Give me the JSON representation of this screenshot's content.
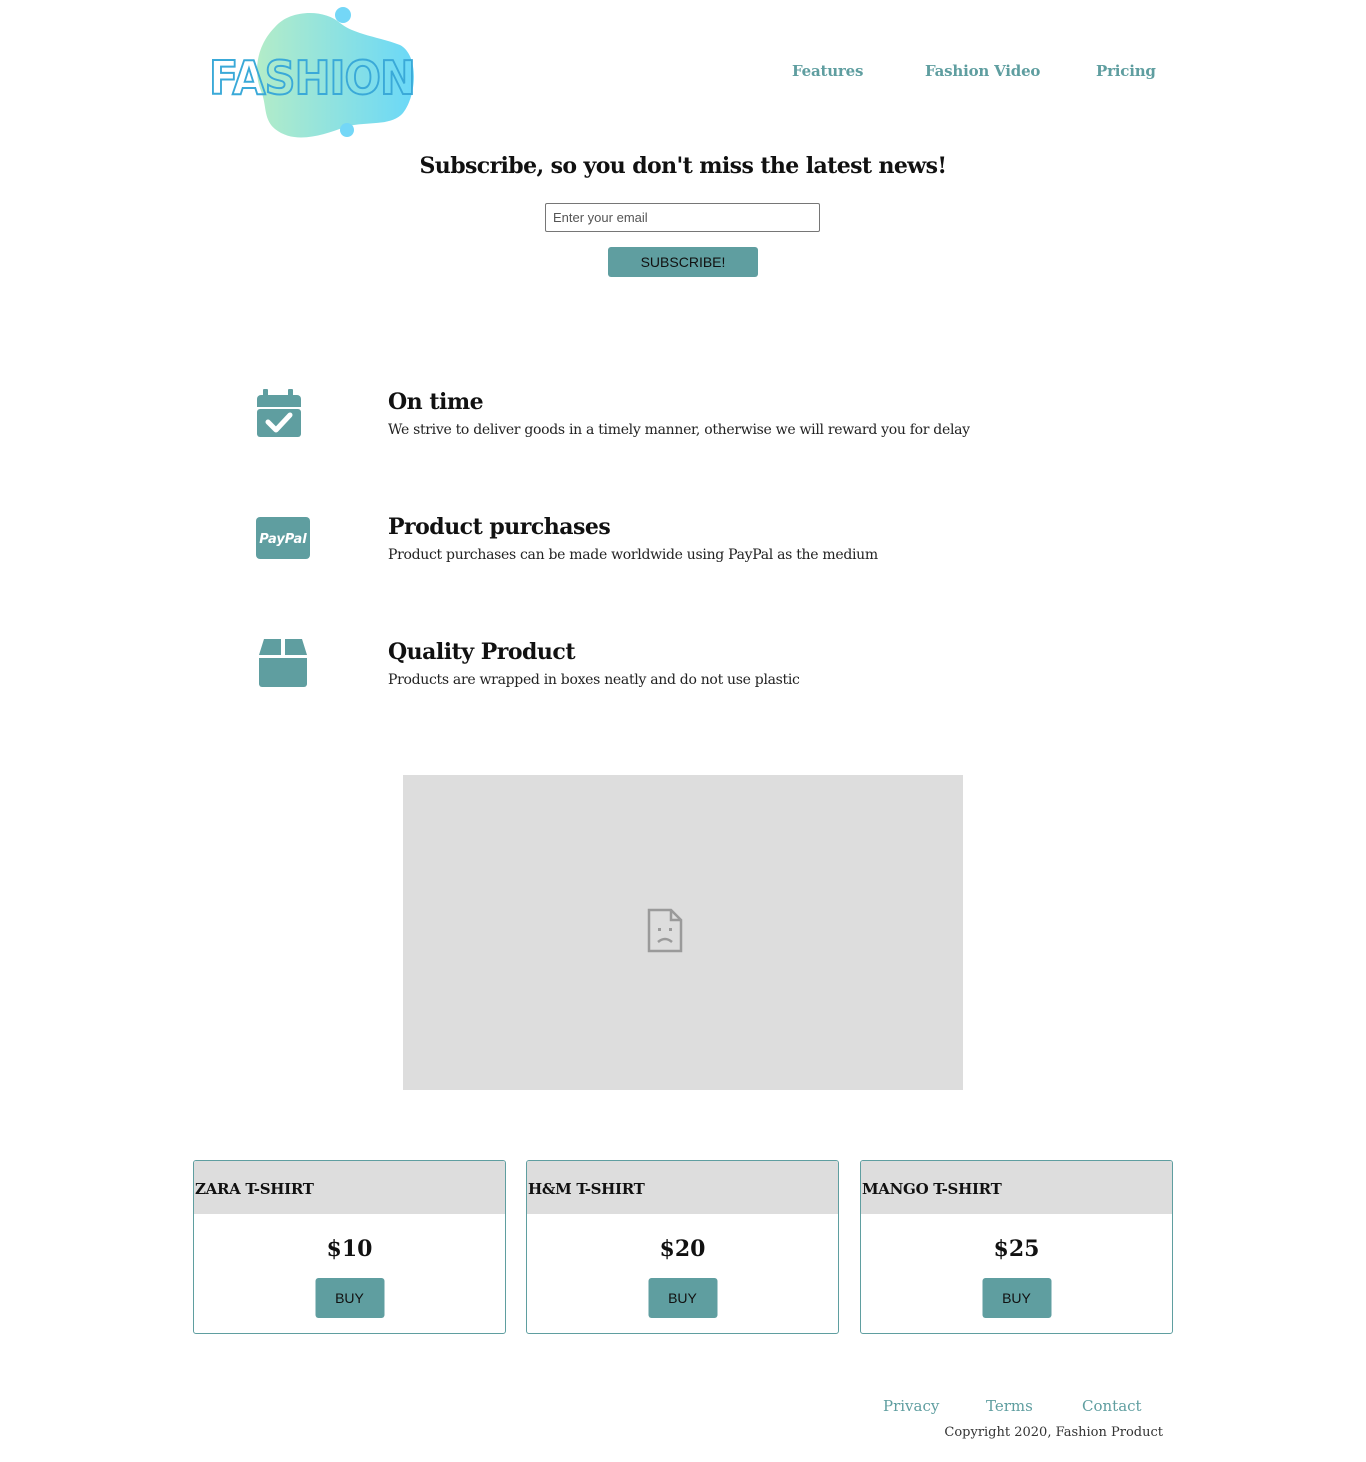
{
  "header": {
    "logo_text": "FASHION",
    "nav": [
      {
        "label": "Features"
      },
      {
        "label": "Fashion Video"
      },
      {
        "label": "Pricing"
      }
    ]
  },
  "subscribe": {
    "title": "Subscribe, so you don't miss the latest news!",
    "email_placeholder": "Enter your email",
    "button_label": "SUBSCRIBE!"
  },
  "features": [
    {
      "icon": "calendar-check-icon",
      "title": "On time",
      "text": "We strive to deliver goods in a timely manner, otherwise we will reward you for delay"
    },
    {
      "icon": "paypal-icon",
      "icon_text": "PayPal",
      "title": "Product purchases",
      "text": "Product purchases can be made worldwide using PayPal as the medium"
    },
    {
      "icon": "box-icon",
      "title": "Quality Product",
      "text": "Products are wrapped in boxes neatly and do not use plastic"
    }
  ],
  "video": {
    "icon": "broken-file-icon"
  },
  "pricing": [
    {
      "name": "ZARA T-SHIRT",
      "price": "$10",
      "button": "BUY"
    },
    {
      "name": "H&M T-SHIRT",
      "price": "$20",
      "button": "BUY"
    },
    {
      "name": "MANGO T-SHIRT",
      "price": "$25",
      "button": "BUY"
    }
  ],
  "footer": {
    "links": [
      {
        "label": "Privacy"
      },
      {
        "label": "Terms"
      },
      {
        "label": "Contact"
      }
    ],
    "copyright": "Copyright 2020, Fashion Product"
  },
  "colors": {
    "accent": "#5f9ea0",
    "placeholder_bg": "#dddddd",
    "logo_gradient_start": "#a8e6c9",
    "logo_gradient_end": "#74d7f7"
  }
}
